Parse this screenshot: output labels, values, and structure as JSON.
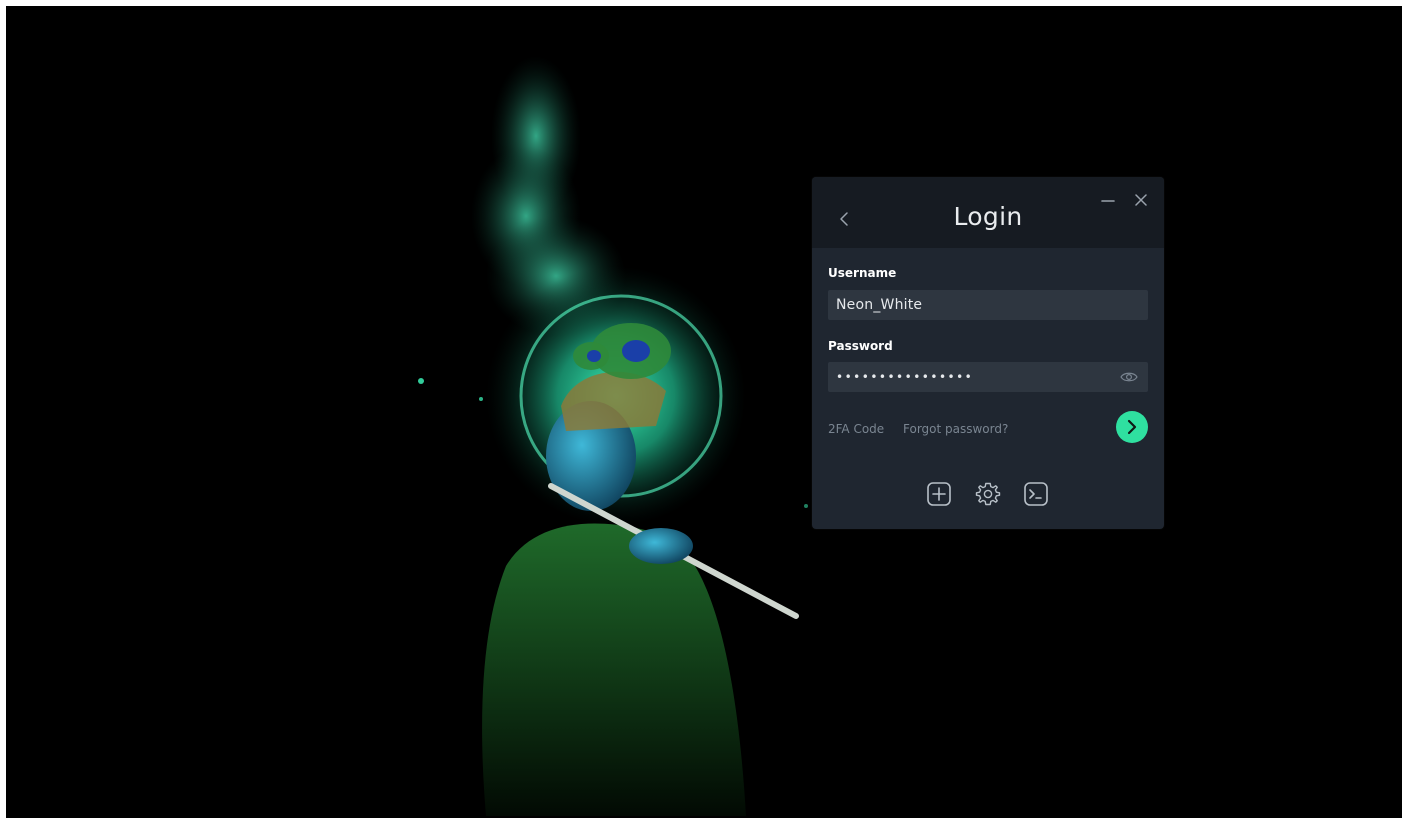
{
  "panel": {
    "title": "Login",
    "username": {
      "label": "Username",
      "value": "Neon_White"
    },
    "password": {
      "label": "Password",
      "value": "••••••••••••••••"
    },
    "links": {
      "twofa": "2FA Code",
      "forgot": "Forgot password?"
    },
    "colors": {
      "accent": "#2fe0a0",
      "panel_bg": "#1f2630",
      "header_bg": "#161b22",
      "field_bg": "#2e3640",
      "muted_text": "#7a8591"
    },
    "icons": {
      "back": "chevron-left-icon",
      "minimize": "minimize-icon",
      "close": "close-icon",
      "show_password": "eye-icon",
      "submit": "chevron-right-icon",
      "add": "plus-square-icon",
      "settings": "gear-icon",
      "terminal": "terminal-icon"
    }
  }
}
